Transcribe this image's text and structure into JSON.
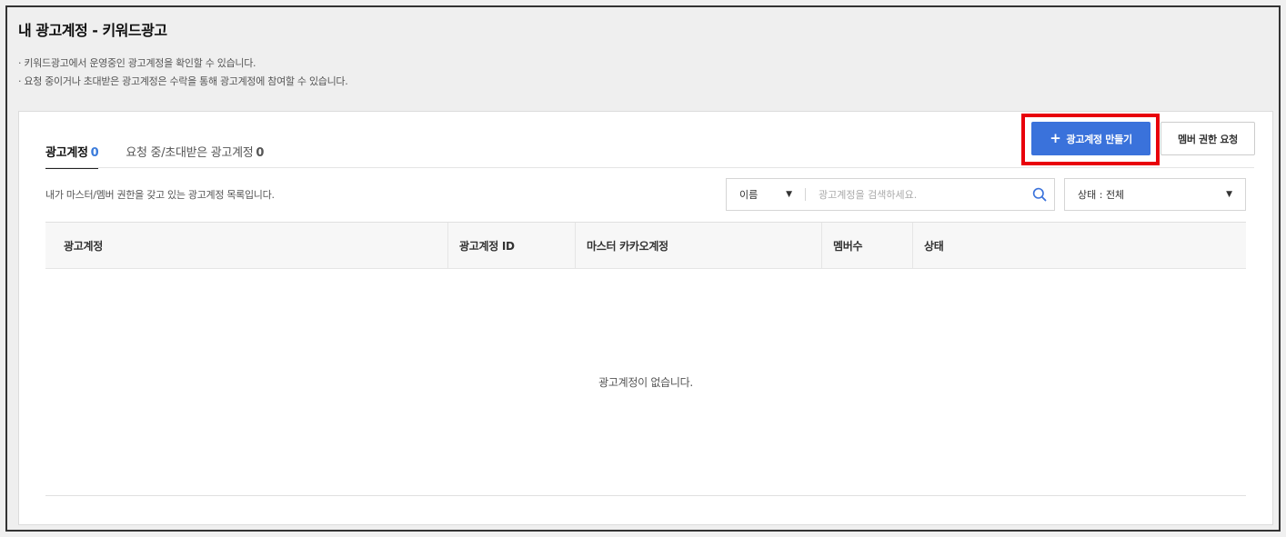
{
  "page": {
    "title": "내 광고계정 - 키워드광고",
    "notices": [
      "· 키워드광고에서 운영중인 광고계정을 확인할 수 있습니다.",
      "· 요청 중이거나 초대받은 광고계정은 수락을 통해 광고계정에 참여할 수 있습니다."
    ]
  },
  "tabs": [
    {
      "label": "광고계정",
      "count": "0",
      "active": true
    },
    {
      "label": "요청 중/초대받은 광고계정",
      "count": "0",
      "active": false
    }
  ],
  "actions": {
    "create_label": "광고계정 만들기",
    "member_request_label": "멤버 권한 요청"
  },
  "list": {
    "description": "내가 마스터/멤버 권한을 갖고 있는 광고계정 목록입니다."
  },
  "search": {
    "field_selected": "이름",
    "placeholder": "광고계정을 검색하세요."
  },
  "status_filter": {
    "selected": "상태 : 전체"
  },
  "table": {
    "columns": [
      "광고계정",
      "광고계정 ID",
      "마스터 카카오계정",
      "멤버수",
      "상태"
    ],
    "empty_message": "광고계정이 없습니다."
  },
  "colors": {
    "primary": "#3a72db",
    "highlight": "#e8000b",
    "active_count": "#3a7bdb"
  },
  "icons": {
    "create": "plus-icon",
    "search": "search-icon",
    "dropdown": "caret-down-icon"
  }
}
